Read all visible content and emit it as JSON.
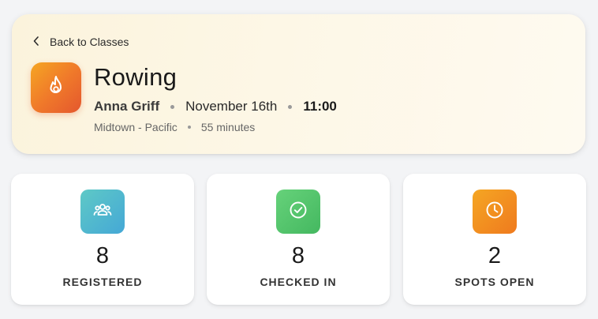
{
  "header": {
    "back_label": "Back to Classes",
    "class_title": "Rowing",
    "instructor": "Anna Griff",
    "date": "November 16th",
    "time": "11:00",
    "location": "Midtown - Pacific",
    "duration": "55 minutes",
    "class_icon": "flame-icon"
  },
  "stats": [
    {
      "value": "8",
      "label": "REGISTERED",
      "icon": "users-group-icon",
      "color": "#4db8d0"
    },
    {
      "value": "8",
      "label": "CHECKED IN",
      "icon": "check-circle-icon",
      "color": "#55c36c"
    },
    {
      "value": "2",
      "label": "SPOTS OPEN",
      "icon": "clock-icon",
      "color": "#f29022"
    }
  ]
}
